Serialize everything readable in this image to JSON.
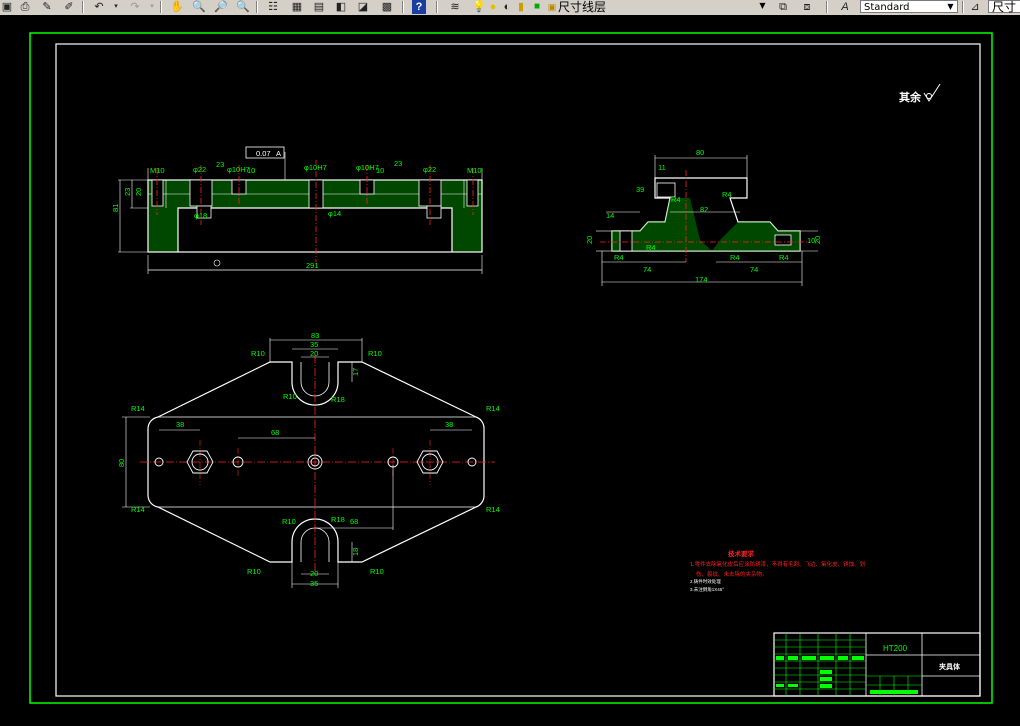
{
  "toolbar": {
    "layer_name": "尺寸线层",
    "text_style": "Standard",
    "dim_style_partial": "尺寸"
  },
  "drawing": {
    "roughness_note": "其余",
    "dims_front": {
      "total": "291",
      "d22l": "φ22",
      "d22r": "φ22",
      "d10h7a": "φ10H7",
      "d10h7b": "φ10H7",
      "d10h7c": "φ10H7",
      "d18": "φ18",
      "d14": "φ14",
      "m10l": "M10",
      "m10r": "M10",
      "v23a": "23",
      "v23b": "23",
      "v10a": "10",
      "v10b": "10",
      "h81": "81",
      "h23": "23",
      "h20": "20",
      "tol": "0.07",
      "datum": "A"
    },
    "dims_side": {
      "w80": "80",
      "w11": "11",
      "w39": "39",
      "h14": "14",
      "h20": "20",
      "w82": "82",
      "r4a": "R4",
      "r4b": "R4",
      "r4c": "R4",
      "r4d": "R4",
      "r4e": "R4",
      "w74a": "74",
      "w74b": "74",
      "w174": "174",
      "h10": "10",
      "h20r": "20",
      "r4f": "R4"
    },
    "dims_top": {
      "w83": "83",
      "w35t": "35",
      "w20t": "20",
      "h17": "17",
      "r10a": "R10",
      "r10b": "R10",
      "r10c": "R10",
      "r18a": "R18",
      "r14a": "R14",
      "r14b": "R14",
      "r14c": "R14",
      "r14d": "R14",
      "w38l": "38",
      "w38r": "38",
      "w68": "68",
      "w68b": "68",
      "h80": "80",
      "r10d": "R10",
      "r18b": "R18",
      "r10e": "R10",
      "r10f": "R10",
      "w20b": "20",
      "w35b": "35",
      "h18": "18"
    },
    "tech_req": {
      "title": "技术要求",
      "line1": "1.零件去除氧化皮后应涂防锈漆，不得有毛刺、飞边、氧化皮、锈蚀、划",
      "line2": "伤、裂纹、未去除的夹杂物。",
      "line3": "2.铸件时效处理",
      "line4": "3.未注倒角1X45°"
    },
    "title_block": {
      "material": "HT200",
      "part_name": "夹具体"
    }
  }
}
